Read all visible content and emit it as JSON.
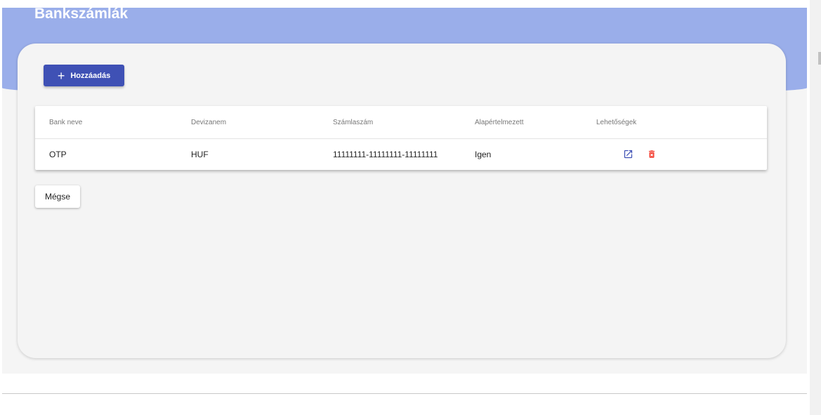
{
  "page": {
    "title": "Bankszámlák"
  },
  "toolbar": {
    "add_label": "Hozzáadás",
    "add_icon": "plus-icon",
    "cancel_label": "Mégse"
  },
  "table": {
    "columns": [
      "Bank neve",
      "Devizanem",
      "Számlaszám",
      "Alapértelmezett",
      "Lehetőségek"
    ],
    "rows": [
      {
        "bank": "OTP",
        "currency": "HUF",
        "account_number": "11111111-11111111-11111111",
        "default": "Igen",
        "actions": [
          "edit-icon",
          "delete-icon"
        ]
      }
    ]
  },
  "colors": {
    "hero": "#9aaeea",
    "primary": "#3f51b5",
    "edit_icon": "#3f51b5",
    "delete_icon": "#f44336",
    "card_background": "#f4f4f4"
  }
}
